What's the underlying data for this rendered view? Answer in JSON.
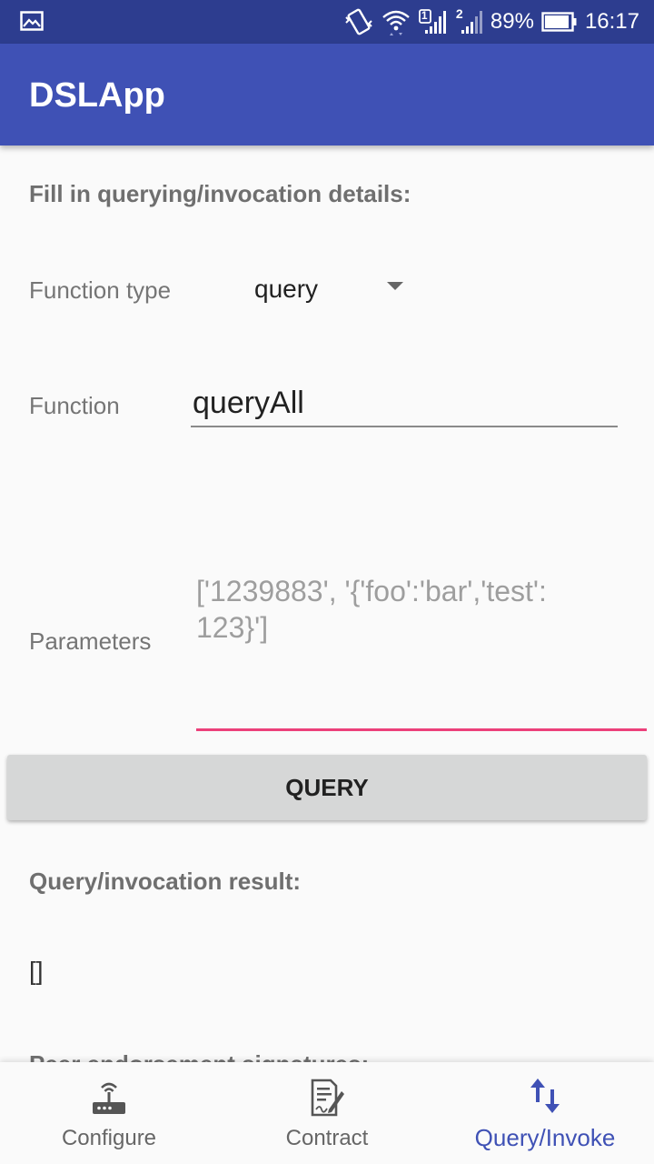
{
  "status_bar": {
    "battery": "89%",
    "time": "16:17",
    "sim1": "1",
    "sim2": "2"
  },
  "app_bar": {
    "title": "DSLApp"
  },
  "form": {
    "heading": "Fill in querying/invocation details:",
    "function_type_label": "Function type",
    "function_type_value": "query",
    "function_label": "Function",
    "function_value": "queryAll",
    "parameters_label": "Parameters",
    "parameters_hint": "['1239883', '{'foo':'bar','test': 123}']",
    "query_button": "QUERY"
  },
  "result": {
    "heading": "Query/invocation result:",
    "value": "[]",
    "next_heading": "Peer endorsement signatures:"
  },
  "bottom_nav": {
    "items": [
      {
        "label": "Configure",
        "icon": "router-icon",
        "active": false
      },
      {
        "label": "Contract",
        "icon": "contract-icon",
        "active": false
      },
      {
        "label": "Query/Invoke",
        "icon": "swap-vert-icon",
        "active": true
      }
    ]
  },
  "colors": {
    "primary": "#3f51b5",
    "primary_dark": "#2d3d8f",
    "accent": "#ec407a"
  }
}
